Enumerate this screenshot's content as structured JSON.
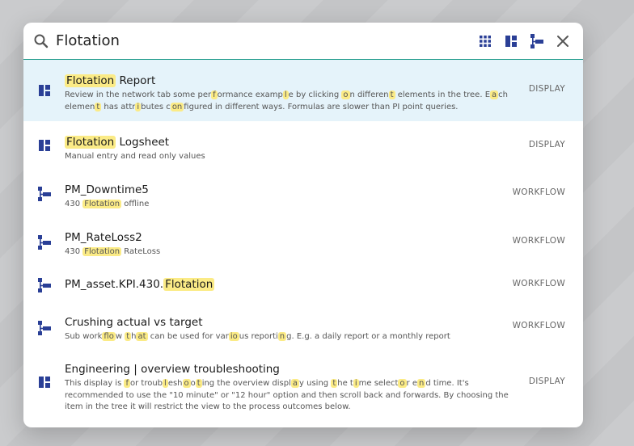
{
  "search": {
    "value": "Flotation",
    "placeholder": ""
  },
  "toolbar": {
    "icons": [
      "grid-icon",
      "display-icon",
      "workflow-icon",
      "close-icon"
    ]
  },
  "colors": {
    "accent": "#1e9b8a",
    "icon": "#2a3f96",
    "highlight": "#fbeb86",
    "active_row": "#e5f3fa"
  },
  "results": [
    {
      "icon": "display-icon",
      "type": "DISPLAY",
      "active": true,
      "title": [
        [
          "Flotation",
          true
        ],
        [
          " Report",
          false
        ]
      ],
      "desc": [
        [
          "Review in the network tab some per",
          false
        ],
        [
          "f",
          true
        ],
        [
          "ormance examp",
          false
        ],
        [
          "l",
          true
        ],
        [
          "e by clicking ",
          false
        ],
        [
          "o",
          true
        ],
        [
          "n differen",
          false
        ],
        [
          "t",
          true
        ],
        [
          " elements in the tree. E",
          false
        ],
        [
          "a",
          true
        ],
        [
          "ch elemen",
          false
        ],
        [
          "t",
          true
        ],
        [
          " has attr",
          false
        ],
        [
          "i",
          true
        ],
        [
          "butes c",
          false
        ],
        [
          "on",
          true
        ],
        [
          "figured in different ways. Formulas are slower than PI point queries.",
          false
        ]
      ]
    },
    {
      "icon": "display-icon",
      "type": "DISPLAY",
      "active": false,
      "title": [
        [
          "Flotation",
          true
        ],
        [
          " Logsheet",
          false
        ]
      ],
      "desc": [
        [
          "Manual entry and read only values",
          false
        ]
      ]
    },
    {
      "icon": "workflow-icon",
      "type": "WORKFLOW",
      "active": false,
      "title": [
        [
          "PM_Downtime5",
          false
        ]
      ],
      "desc": [
        [
          "430 ",
          false
        ],
        [
          "Flotation",
          true
        ],
        [
          " offline",
          false
        ]
      ]
    },
    {
      "icon": "workflow-icon",
      "type": "WORKFLOW",
      "active": false,
      "title": [
        [
          "PM_RateLoss2",
          false
        ]
      ],
      "desc": [
        [
          "430 ",
          false
        ],
        [
          "Flotation",
          true
        ],
        [
          " RateLoss",
          false
        ]
      ]
    },
    {
      "icon": "workflow-icon",
      "type": "WORKFLOW",
      "active": false,
      "title": [
        [
          "PM_asset.KPI.430.",
          false
        ],
        [
          "Flotation",
          true
        ]
      ],
      "desc": []
    },
    {
      "icon": "workflow-icon",
      "type": "WORKFLOW",
      "active": false,
      "title": [
        [
          "Crushing actual vs target",
          false
        ]
      ],
      "desc": [
        [
          "Sub work",
          false
        ],
        [
          "flo",
          true
        ],
        [
          "w ",
          false
        ],
        [
          "t",
          true
        ],
        [
          "h",
          false
        ],
        [
          "at",
          true
        ],
        [
          " can be used for var",
          false
        ],
        [
          "io",
          true
        ],
        [
          "us reporti",
          false
        ],
        [
          "n",
          true
        ],
        [
          "g. E.g. a daily report or a monthly report",
          false
        ]
      ]
    },
    {
      "icon": "display-icon",
      "type": "DISPLAY",
      "active": false,
      "title": [
        [
          "Engineering | overview troubleshooting",
          false
        ]
      ],
      "desc": [
        [
          "This display is ",
          false
        ],
        [
          "f",
          true
        ],
        [
          "or troub",
          false
        ],
        [
          "l",
          true
        ],
        [
          "esh",
          false
        ],
        [
          "o",
          true
        ],
        [
          "o",
          false
        ],
        [
          "t",
          true
        ],
        [
          "ing the overview displ",
          false
        ],
        [
          "a",
          true
        ],
        [
          "y using ",
          false
        ],
        [
          "t",
          true
        ],
        [
          "he t",
          false
        ],
        [
          "i",
          true
        ],
        [
          "me select",
          false
        ],
        [
          "o",
          true
        ],
        [
          "r e",
          false
        ],
        [
          "n",
          true
        ],
        [
          "d time. It's recommended to use the \"10 minute\" or \"12 hour\" option and then scroll back and forwards. By choosing the item in the tree it will restrict the view to the process outcomes below.",
          false
        ]
      ]
    }
  ]
}
